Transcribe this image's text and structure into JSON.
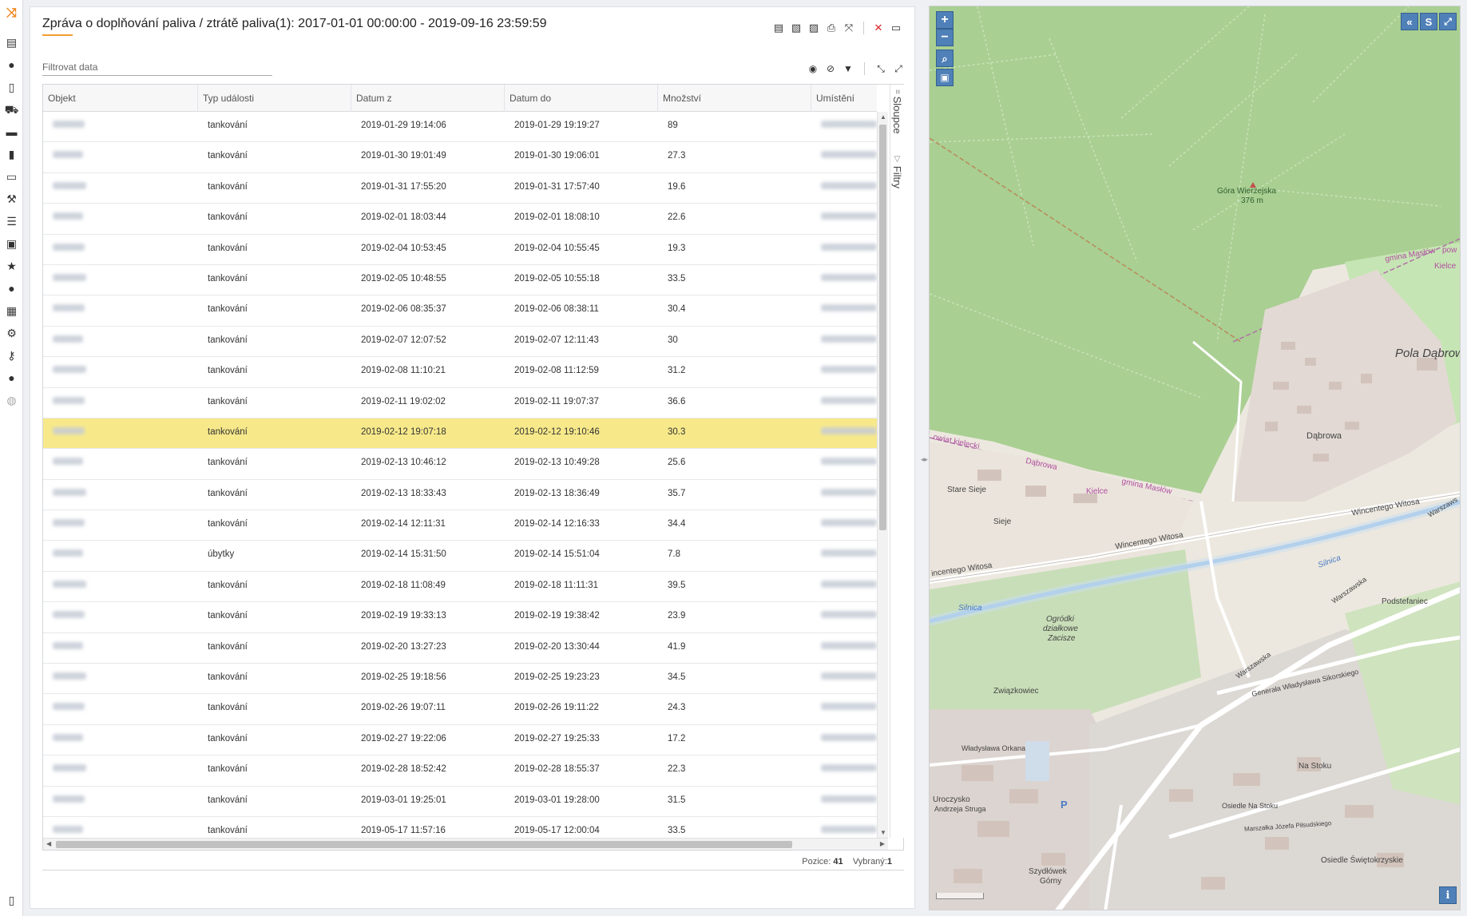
{
  "report": {
    "title": "Zpráva o doplňování paliva / ztrátě paliva(1): 2017-01-01 00:00:00 - 2019-09-16 23:59:59",
    "filter_placeholder": "Filtrovat data",
    "side_tabs": [
      "Sloupce",
      "Filtry"
    ],
    "status": {
      "position_label": "Pozice:",
      "position_value": "41",
      "selected_label": "Vybraný:",
      "selected_value": "1"
    }
  },
  "columns": [
    "Objekt",
    "Typ události",
    "Datum z",
    "Datum do",
    "Množství",
    "Umístění"
  ],
  "rows": [
    {
      "type": "tankování",
      "from": "2019-01-29 19:14:06",
      "to": "2019-01-29 19:19:27",
      "qty": "89"
    },
    {
      "type": "tankování",
      "from": "2019-01-30 19:01:49",
      "to": "2019-01-30 19:06:01",
      "qty": "27.3"
    },
    {
      "type": "tankování",
      "from": "2019-01-31 17:55:20",
      "to": "2019-01-31 17:57:40",
      "qty": "19.6"
    },
    {
      "type": "tankování",
      "from": "2019-02-01 18:03:44",
      "to": "2019-02-01 18:08:10",
      "qty": "22.6"
    },
    {
      "type": "tankování",
      "from": "2019-02-04 10:53:45",
      "to": "2019-02-04 10:55:45",
      "qty": "19.3"
    },
    {
      "type": "tankování",
      "from": "2019-02-05 10:48:55",
      "to": "2019-02-05 10:55:18",
      "qty": "33.5"
    },
    {
      "type": "tankování",
      "from": "2019-02-06 08:35:37",
      "to": "2019-02-06 08:38:11",
      "qty": "30.4"
    },
    {
      "type": "tankování",
      "from": "2019-02-07 12:07:52",
      "to": "2019-02-07 12:11:43",
      "qty": "30"
    },
    {
      "type": "tankování",
      "from": "2019-02-08 11:10:21",
      "to": "2019-02-08 11:12:59",
      "qty": "31.2"
    },
    {
      "type": "tankování",
      "from": "2019-02-11 19:02:02",
      "to": "2019-02-11 19:07:37",
      "qty": "36.6"
    },
    {
      "type": "tankování",
      "from": "2019-02-12 19:07:18",
      "to": "2019-02-12 19:10:46",
      "qty": "30.3",
      "selected": true
    },
    {
      "type": "tankování",
      "from": "2019-02-13 10:46:12",
      "to": "2019-02-13 10:49:28",
      "qty": "25.6"
    },
    {
      "type": "tankování",
      "from": "2019-02-13 18:33:43",
      "to": "2019-02-13 18:36:49",
      "qty": "35.7"
    },
    {
      "type": "tankování",
      "from": "2019-02-14 12:11:31",
      "to": "2019-02-14 12:16:33",
      "qty": "34.4"
    },
    {
      "type": "úbytky",
      "from": "2019-02-14 15:31:50",
      "to": "2019-02-14 15:51:04",
      "qty": "7.8"
    },
    {
      "type": "tankování",
      "from": "2019-02-18 11:08:49",
      "to": "2019-02-18 11:11:31",
      "qty": "39.5"
    },
    {
      "type": "tankování",
      "from": "2019-02-19 19:33:13",
      "to": "2019-02-19 19:38:42",
      "qty": "23.9"
    },
    {
      "type": "tankování",
      "from": "2019-02-20 13:27:23",
      "to": "2019-02-20 13:30:44",
      "qty": "41.9"
    },
    {
      "type": "tankování",
      "from": "2019-02-25 19:18:56",
      "to": "2019-02-25 19:23:23",
      "qty": "34.5"
    },
    {
      "type": "tankování",
      "from": "2019-02-26 19:07:11",
      "to": "2019-02-26 19:11:22",
      "qty": "24.3"
    },
    {
      "type": "tankování",
      "from": "2019-02-27 19:22:06",
      "to": "2019-02-27 19:25:33",
      "qty": "17.2"
    },
    {
      "type": "tankování",
      "from": "2019-02-28 18:52:42",
      "to": "2019-02-28 18:55:37",
      "qty": "22.3"
    },
    {
      "type": "tankování",
      "from": "2019-03-01 19:25:01",
      "to": "2019-03-01 19:28:00",
      "qty": "31.5"
    },
    {
      "type": "tankování",
      "from": "2019-05-17 11:57:16",
      "to": "2019-05-17 12:00:04",
      "qty": "33.5"
    }
  ],
  "map": {
    "labels": {
      "gora": "Góra Wierzejska",
      "gora_height": "376 m",
      "gmina": "gmina Masłów",
      "pow": "pow",
      "kielce": "Kielce",
      "pola": "Pola Dąbrow",
      "dabrowa": "Dąbrowa",
      "dabrowa2": "Dąbrowa",
      "gmina2": "gmina Masłów",
      "kielce2": "Kielce",
      "owiat": "owiat kielecki",
      "stare_sieje": "Stare Sieje",
      "sieje": "Sieje",
      "witosa": "Wincentego Witosa",
      "witosa2": "Wincentego Witosa",
      "witosa3": "incentego Witosa",
      "silnica": "Silnica",
      "silnica2": "Silnica",
      "ogrodki": "Ogródki",
      "dzialkowe": "działkowe",
      "zacisze": "Zacisze",
      "podstefaniec": "Podstefaniec",
      "warszawska": "Warszawska",
      "warszawska2": "Warszawska",
      "sikorskiego": "Generała Władysława Sikorskiego",
      "zwiazkowiec": "Związkowiec",
      "orkana": "Władysława Orkana",
      "na_stoku": "Na Stoku",
      "osiedle_na_stoku": "Osiedle Na Stoku",
      "pilsudskiego": "Marszałka Józefa Piłsudskiego",
      "swietokrzyskie": "Osiedle Świętokrzyskie",
      "uroczysko": "Uroczysko",
      "strugi": "Andrzeja Struga",
      "szydlowek": "Szydłówek",
      "gorny": "Górny",
      "p": "P",
      "warszaws": "Warszaws"
    },
    "controls": {
      "zoom_in": "+",
      "zoom_out": "−",
      "collapse": "«",
      "s_button": "S",
      "info": "i"
    }
  }
}
